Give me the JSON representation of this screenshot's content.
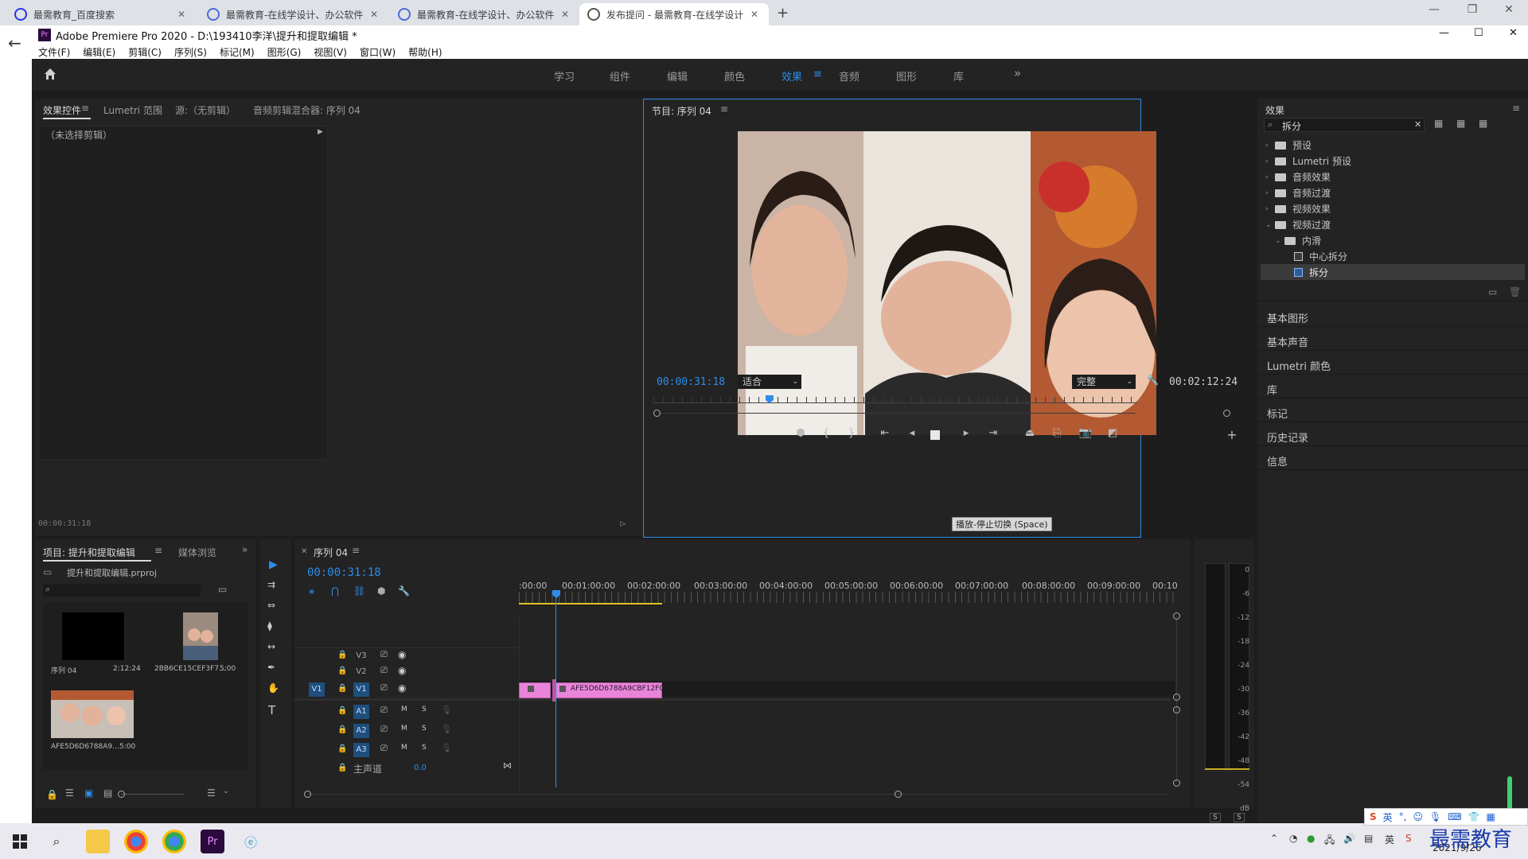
{
  "browser": {
    "tabs": [
      {
        "title": "最需教育_百度搜索",
        "active": false
      },
      {
        "title": "最需教育-在线学设计、办公软件",
        "active": false
      },
      {
        "title": "最需教育-在线学设计、办公软件",
        "active": false
      },
      {
        "title": "发布提问 - 最需教育-在线学设计",
        "active": true
      }
    ],
    "new_tab": "+",
    "window_controls": [
      "—",
      "❐",
      "✕"
    ]
  },
  "app": {
    "logo": "Pr",
    "title": "Adobe Premiere Pro 2020 - D:\\193410李洋\\提升和提取编辑 *",
    "window_controls": [
      "—",
      "☐",
      "✕"
    ],
    "menu": [
      "文件(F)",
      "编辑(E)",
      "剪辑(C)",
      "序列(S)",
      "标记(M)",
      "图形(G)",
      "视图(V)",
      "窗口(W)",
      "帮助(H)"
    ],
    "workspaces": [
      "学习",
      "组件",
      "编辑",
      "颜色",
      "效果",
      "音频",
      "图形",
      "库"
    ],
    "active_workspace": "效果",
    "more_workspaces": "»"
  },
  "source_panel": {
    "tabs": [
      "效果控件",
      "Lumetri 范围",
      "源:（无剪辑）",
      "音频剪辑混合器: 序列 04"
    ],
    "active_tab": "效果控件",
    "no_clip": "（未选择剪辑）",
    "timecode": "00:00:31:18"
  },
  "program_monitor": {
    "tab": "节目: 序列 04",
    "current_time": "00:00:31:18",
    "fit": "适合",
    "quality": "完整",
    "duration": "00:02:12:24",
    "playhead_fraction": 0.24,
    "tooltip": "播放-停止切换 (Space)"
  },
  "effects_panel": {
    "title": "效果",
    "search_value": "拆分",
    "tree": [
      {
        "label": "预设",
        "level": 0,
        "type": "folder"
      },
      {
        "label": "Lumetri 预设",
        "level": 0,
        "type": "folder"
      },
      {
        "label": "音频效果",
        "level": 0,
        "type": "folder"
      },
      {
        "label": "音频过渡",
        "level": 0,
        "type": "folder"
      },
      {
        "label": "视频效果",
        "level": 0,
        "type": "folder"
      },
      {
        "label": "视频过渡",
        "level": 0,
        "type": "folder",
        "expanded": true
      },
      {
        "label": "内滑",
        "level": 1,
        "type": "folder",
        "expanded": true
      },
      {
        "label": "中心拆分",
        "level": 2,
        "type": "effect"
      },
      {
        "label": "拆分",
        "level": 2,
        "type": "effect",
        "selected": true
      }
    ],
    "sections": [
      "基本图形",
      "基本声音",
      "Lumetri 颜色",
      "库",
      "标记",
      "历史记录",
      "信息"
    ]
  },
  "project_panel": {
    "tabs": [
      "项目: 提升和提取编辑",
      "媒体浏览"
    ],
    "file": "提升和提取编辑.prproj",
    "items": [
      {
        "name": "序列 04",
        "duration": "2:12:24"
      },
      {
        "name": "2BB6CE15CEF3F7...",
        "duration": "5:00"
      },
      {
        "name": "AFE5D6D6788A9...",
        "duration": "5:00"
      }
    ]
  },
  "timeline": {
    "tab": "序列 04",
    "timecode": "00:00:31:18",
    "ruler": [
      ":00:00",
      "00:01:00:00",
      "00:02:00:00",
      "00:03:00:00",
      "00:04:00:00",
      "00:05:00:00",
      "00:06:00:00",
      "00:07:00:00",
      "00:08:00:00",
      "00:09:00:00",
      "00:10"
    ],
    "video_tracks": [
      "V3",
      "V2",
      "V1"
    ],
    "audio_tracks": [
      "A1",
      "A2",
      "A3"
    ],
    "source_patch": "V1",
    "master_label": "主声道",
    "master_value": "0.0",
    "clip_name": "AFE5D6D6788A9CBF12F0",
    "mute": "M",
    "solo": "S"
  },
  "audio_meter": {
    "scale": [
      "0",
      "-6",
      "-12",
      "-18",
      "-24",
      "-30",
      "-36",
      "-42",
      "-48",
      "-54",
      "dB"
    ],
    "solo_buttons": [
      "S",
      "S"
    ]
  },
  "taskbar": {
    "ime_lang": "英",
    "clock": "2021/9/26",
    "watermark": "最需教育"
  },
  "colors": {
    "accent": "#2d8ceb",
    "clip": "#e985d8",
    "panel": "#232323",
    "bg": "#1d1d1d"
  }
}
